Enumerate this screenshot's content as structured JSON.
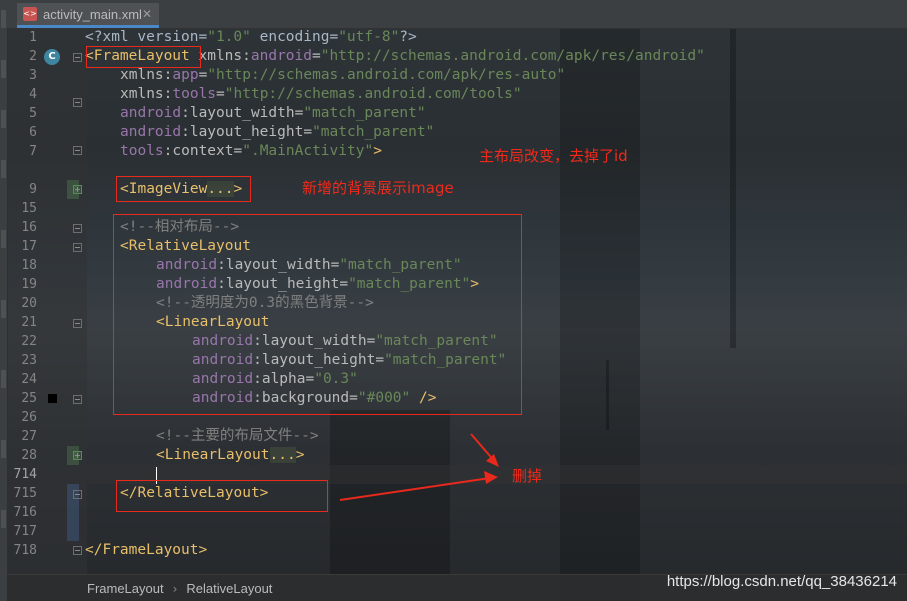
{
  "tab": {
    "file_name": "activity_main.xml",
    "close": "✕",
    "icon_text": "<>"
  },
  "gutter": {
    "line_numbers": [
      "1",
      "2",
      "3",
      "4",
      "5",
      "6",
      "7",
      "9",
      "15",
      "16",
      "17",
      "18",
      "19",
      "20",
      "21",
      "22",
      "23",
      "24",
      "25",
      "26",
      "27",
      "28",
      "714",
      "715",
      "716",
      "717",
      "718"
    ],
    "class_marker": "C"
  },
  "code": {
    "l1": [
      "<?xml version=",
      "\"1.0\"",
      " encoding=",
      "\"utf-8\"",
      "?>"
    ],
    "l2": [
      "<FrameLayout",
      " xmlns:",
      "android",
      "=",
      "\"http://schemas.android.com/apk/res/android\""
    ],
    "l3": [
      "xmlns:",
      "app",
      "=",
      "\"http://schemas.android.com/apk/res-auto\""
    ],
    "l4": [
      "xmlns:",
      "tools",
      "=",
      "\"http://schemas.android.com/tools\""
    ],
    "l5": [
      "android",
      ":layout_width=",
      "\"match_parent\""
    ],
    "l6": [
      "android",
      ":layout_height=",
      "\"match_parent\""
    ],
    "l7": [
      "tools",
      ":context=",
      "\".MainActivity\"",
      ">"
    ],
    "l9": [
      "<ImageView",
      "...",
      ">"
    ],
    "l16": "<!--相对布局-->",
    "l17": "<RelativeLayout",
    "l18": [
      "android",
      ":layout_width=",
      "\"match_parent\""
    ],
    "l19": [
      "android",
      ":layout_height=",
      "\"match_parent\"",
      ">"
    ],
    "l20": "<!--透明度为0.3的黑色背景-->",
    "l21": "<LinearLayout",
    "l22": [
      "android",
      ":layout_width=",
      "\"match_parent\""
    ],
    "l23": [
      "android",
      ":layout_height=",
      "\"match_parent\""
    ],
    "l24": [
      "android",
      ":alpha=",
      "\"0.3\""
    ],
    "l25": [
      "android",
      ":background=",
      "\"#000\"",
      " />"
    ],
    "l27": "<!--主要的布局文件-->",
    "l28": [
      "<LinearLayout",
      "...",
      ">"
    ],
    "l715": "</RelativeLayout>",
    "l718": "</FrameLayout>"
  },
  "annotations": {
    "root_changed": "主布局改变，去掉了id",
    "new_background": "新增的背景展示image",
    "delete": "删掉"
  },
  "breadcrumbs": [
    "FrameLayout",
    "RelativeLayout"
  ],
  "watermark": "https://blog.csdn.net/qq_38436214",
  "colors": {
    "annotation": "#e8291c",
    "tag": "#e8bf6a",
    "namespace": "#9876aa",
    "value": "#6a8759",
    "comment": "#808080"
  }
}
